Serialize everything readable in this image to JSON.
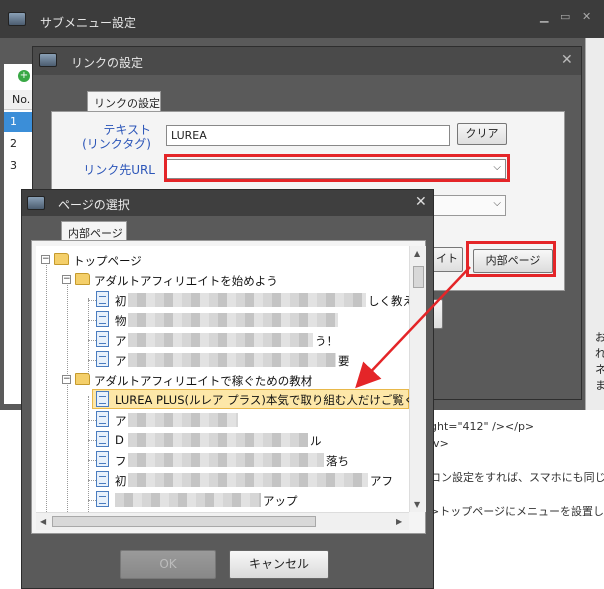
{
  "main_window": {
    "title": "サブメニュー設定",
    "grid_header": "No.",
    "rows": [
      "1",
      "2",
      "3"
    ],
    "code_lines": [
      "ght=\"412\" /></p>",
      "iv>",
      "",
      "コン設定をすれば、スマホにも同じよ",
      "",
      ">トップページにメニューを設置してみ"
    ],
    "side_text": [
      "お",
      "れ",
      "",
      "",
      "ネ",
      "ま"
    ]
  },
  "link_dialog": {
    "title": "リンクの設定",
    "tab_label": "リンクの設定",
    "text_label": "テキスト\n(リンクタグ)",
    "text_value": "LUREA",
    "clear_button": "クリア",
    "url_label": "リンク先URL",
    "url_value": "",
    "partial_button_text": "イト",
    "internal_page_button": "内部ページ"
  },
  "page_dialog": {
    "title": "ページの選択",
    "tab_label": "内部ページ",
    "tree": {
      "root": "トップページ",
      "folder1": "アダルトアフィリエイトを始めよう",
      "folder1_items": [
        {
          "prefix": "初",
          "suffix": "しく教え"
        },
        {
          "prefix": "物",
          "suffix": ""
        },
        {
          "prefix": "ア",
          "suffix": "う！"
        },
        {
          "prefix": "ア",
          "suffix": "要"
        }
      ],
      "folder2": "アダルトアフィリエイトで稼ぐための教材",
      "selected_item": "LUREA PLUS(ルレア プラス)本気で取り組む人だけご覧く",
      "folder2_items": [
        {
          "prefix": "ア",
          "suffix": ""
        },
        {
          "prefix": "D",
          "suffix": "ル"
        },
        {
          "prefix": "フ",
          "suffix": "落ち"
        },
        {
          "prefix": "初",
          "suffix": "アフ"
        },
        {
          "prefix": "",
          "suffix": "アップ"
        }
      ]
    },
    "ok_button": "OK",
    "cancel_button": "キャンセル"
  },
  "colors": {
    "highlight_red": "#e42528",
    "selection_bg": "#fde7a8",
    "label_blue": "#2b55b8"
  }
}
